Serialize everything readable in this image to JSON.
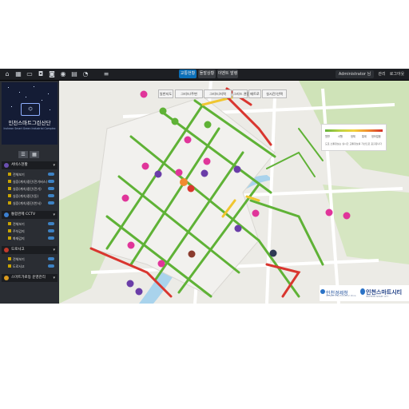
{
  "topbar": {
    "icons": [
      "home-icon",
      "grid-icon",
      "monitor-icon",
      "car-icon",
      "camera-icon",
      "pin-icon",
      "chart-icon",
      "alarm-icon",
      "menu-icon"
    ],
    "tabs": [
      "교통현황",
      "돌발상황",
      "이벤트 발령"
    ],
    "active_tab": 0,
    "user": "Administrator 님",
    "buttons": [
      "관리",
      "로그아웃"
    ]
  },
  "sidebar": {
    "title": "인천스마트그린산단",
    "subtitle": "Incheon Smart Green Industrial Complex",
    "sections": [
      {
        "label": "서비스현황",
        "items": [
          "전체보기",
          "실증(계속)중단(전기버스)",
          "실증(계속)중단(전기)",
          "실증(계속)중단(동)",
          "실증(계속)중단(반사)"
        ]
      },
      {
        "label": "통합관제 CCTV",
        "items": [
          "전체보기",
          "주차감지",
          "화재감지"
        ]
      },
      {
        "label": "도로사고",
        "items": [
          "전체보기",
          "도로사고"
        ]
      },
      {
        "label": "스마트가로등 운영관리"
      }
    ]
  },
  "map": {
    "controls": [
      "일반지도",
      "그리드/주변",
      "그리드/지역",
      "그리드 관광",
      "메트로",
      "실시간/선택"
    ],
    "legend": {
      "labels": [
        "원활",
        "서행",
        "정체",
        "통제",
        "정보없음"
      ],
      "note": "도로 소통정보는 실시간 교통정보를 기반으로 표출됩니다"
    },
    "logos": {
      "left": "인천경제청",
      "left_sub": "Incheon Free Economic Zone",
      "right": "인천스마트시티",
      "right_sub": "INCHEON SMART CITY"
    }
  },
  "colors": {
    "flow_good": "#5fb236",
    "flow_slow": "#f0c630",
    "flow_jam": "#d9362f",
    "marker_pink": "#e0359a",
    "marker_purple": "#6a3da8",
    "accent": "#0b6fb8"
  }
}
